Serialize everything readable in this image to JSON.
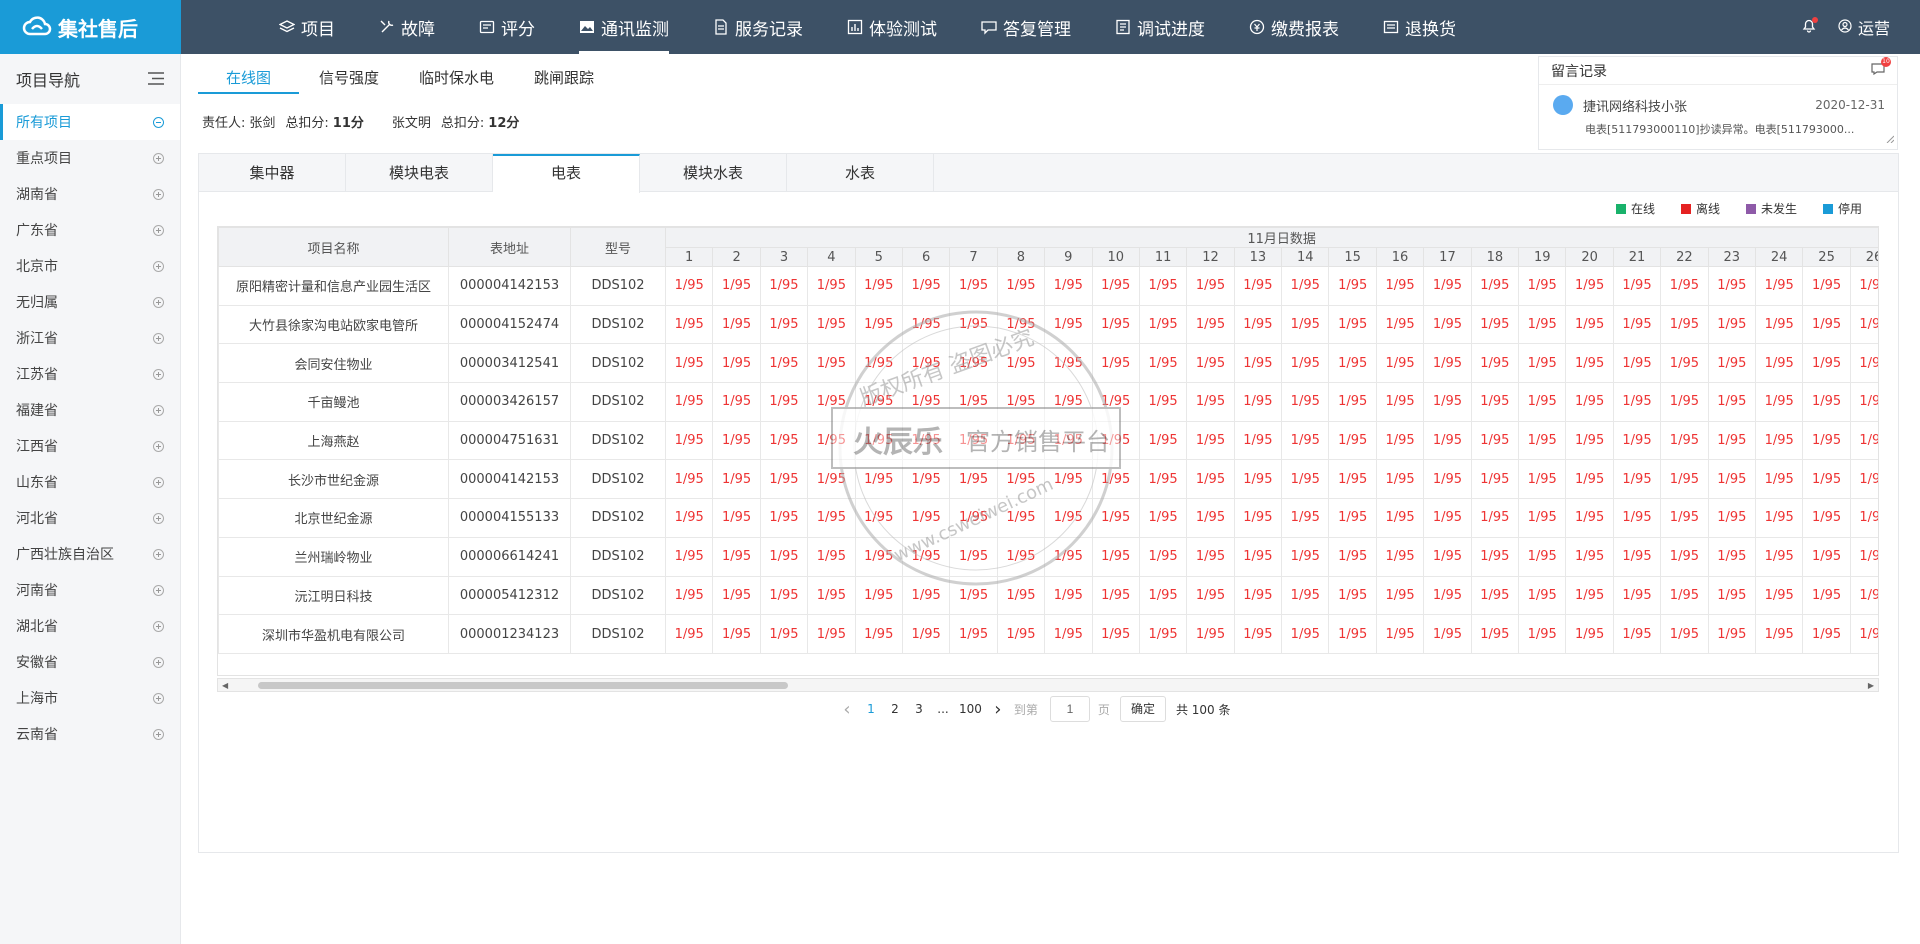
{
  "app": {
    "logo": "集社售后"
  },
  "nav": [
    {
      "label": "项目",
      "icon": "layers-icon"
    },
    {
      "label": "故障",
      "icon": "tools-icon"
    },
    {
      "label": "评分",
      "icon": "score-icon"
    },
    {
      "label": "通讯监测",
      "icon": "image-icon",
      "active": true
    },
    {
      "label": "服务记录",
      "icon": "document-icon"
    },
    {
      "label": "体验测试",
      "icon": "chart-icon"
    },
    {
      "label": "答复管理",
      "icon": "chat-icon"
    },
    {
      "label": "调试进度",
      "icon": "progress-icon"
    },
    {
      "label": "缴费报表",
      "icon": "coin-icon"
    },
    {
      "label": "退换货",
      "icon": "return-icon"
    }
  ],
  "user": {
    "name": "运营"
  },
  "sidebar": {
    "title": "项目导航",
    "items": [
      "所有项目",
      "重点项目",
      "湖南省",
      "广东省",
      "北京市",
      "无归属",
      "浙江省",
      "江苏省",
      "福建省",
      "江西省",
      "山东省",
      "河北省",
      "广西壮族自治区",
      "河南省",
      "湖北省",
      "安徽省",
      "上海市",
      "云南省"
    ]
  },
  "subtabs": [
    "在线图",
    "信号强度",
    "临时保水电",
    "跳闸跟踪"
  ],
  "resp": {
    "label1": "责任人:",
    "name1": "张剑",
    "score_label1": "总扣分:",
    "score1": "11分",
    "name2": "张文明",
    "score_label2": "总扣分:",
    "score2": "12分"
  },
  "messages": {
    "title": "留言记录",
    "badge": "10",
    "sender": "捷讯网络科技小张",
    "date": "2020-12-31",
    "text": "电表[511793000110]抄读异常。电表[511793000..."
  },
  "devtabs": [
    "集中器",
    "模块电表",
    "电表",
    "模块水表",
    "水表"
  ],
  "legend": [
    {
      "label": "在线",
      "color": "#19b26b"
    },
    {
      "label": "离线",
      "color": "#e52222"
    },
    {
      "label": "未发生",
      "color": "#8e5aa8"
    },
    {
      "label": "停用",
      "color": "#1a9bd7"
    }
  ],
  "table": {
    "headers": {
      "name": "项目名称",
      "addr": "表地址",
      "model": "型号",
      "group": "11月日数据"
    },
    "days": [
      "1",
      "2",
      "3",
      "4",
      "5",
      "6",
      "7",
      "8",
      "9",
      "10",
      "11",
      "12",
      "13",
      "14",
      "15",
      "16",
      "17",
      "18",
      "19",
      "20",
      "21",
      "22",
      "23",
      "24",
      "25",
      "26"
    ],
    "cell": "1/95",
    "rows": [
      {
        "name": "原阳精密计量和信息产业园生活区",
        "addr": "000004142153",
        "model": "DDS102"
      },
      {
        "name": "大竹县徐家沟电站欧家电管所",
        "addr": "000004152474",
        "model": "DDS102"
      },
      {
        "name": "会同安住物业",
        "addr": "000003412541",
        "model": "DDS102"
      },
      {
        "name": "千亩鳗池",
        "addr": "000003426157",
        "model": "DDS102"
      },
      {
        "name": "上海燕赵",
        "addr": "000004751631",
        "model": "DDS102"
      },
      {
        "name": "长沙市世纪金源",
        "addr": "000004142153",
        "model": "DDS102"
      },
      {
        "name": "北京世纪金源",
        "addr": "000004155133",
        "model": "DDS102"
      },
      {
        "name": "兰州瑞岭物业",
        "addr": "000006614241",
        "model": "DDS102"
      },
      {
        "name": "沅江明日科技",
        "addr": "000005412312",
        "model": "DDS102"
      },
      {
        "name": "深圳市华盈机电有限公司",
        "addr": "000001234123",
        "model": "DDS102"
      }
    ]
  },
  "pager": {
    "pages": [
      "1",
      "2",
      "3"
    ],
    "ellipsis": "...",
    "last": "100",
    "goto_label": "到第",
    "goto_value": "1",
    "page_unit": "页",
    "confirm": "确定",
    "total": "共 100 条"
  },
  "watermark": {
    "arc_text": "版权所有 盗图必究",
    "brand": "火辰乐",
    "subtitle": "官方销售平台",
    "url": "www.csweiwei.com"
  }
}
